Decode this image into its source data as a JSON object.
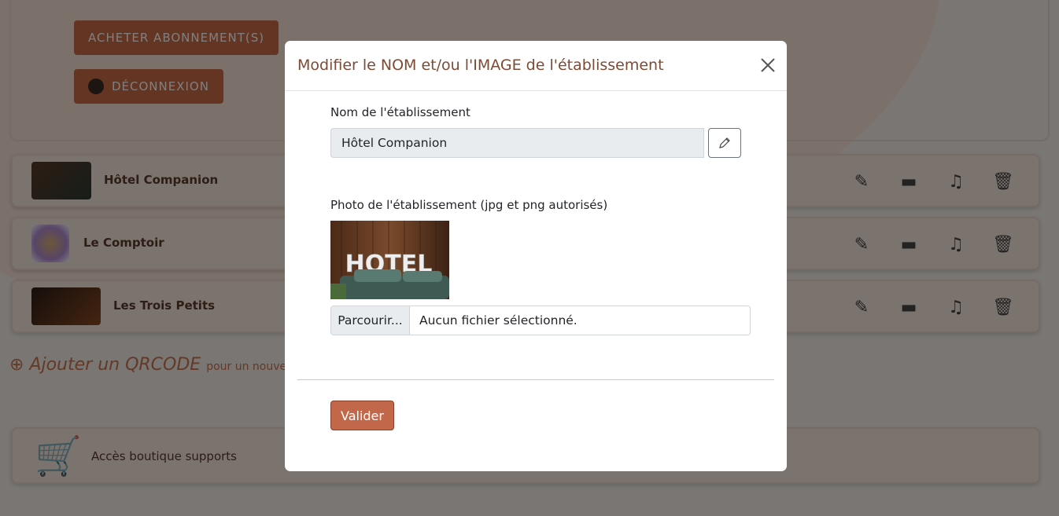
{
  "background": {
    "buttons": [
      "ACHETER ABONNEMENT(S)",
      "DÉCONNEXION"
    ],
    "establishments": [
      {
        "name": "Hôtel Companion"
      },
      {
        "name": "Le Comptoir"
      },
      {
        "name": "Les Trois Petits"
      }
    ],
    "row_icons": [
      "edit-icon",
      "image-icon",
      "bell-icon",
      "trash-icon"
    ],
    "qr_link": "Ajouter un QRCODE",
    "qr_link_suffix": "pour un nouvel",
    "shop_label": "Accès boutique supports"
  },
  "modal": {
    "title": "Modifier le NOM et/ou l'IMAGE de l'établissement",
    "name_label": "Nom de l'établissement",
    "name_value": "Hôtel Companion",
    "photo_label": "Photo de l'établissement (jpg et png autorisés)",
    "photo_text": "HOTEL",
    "file_button": "Parcourir...",
    "file_status": "Aucun fichier sélectionné.",
    "submit_label": "Valider"
  },
  "colors": {
    "title": "#7d4a34",
    "accent": "#c2674a",
    "overlay": "rgba(0,0,0,0.5)"
  }
}
